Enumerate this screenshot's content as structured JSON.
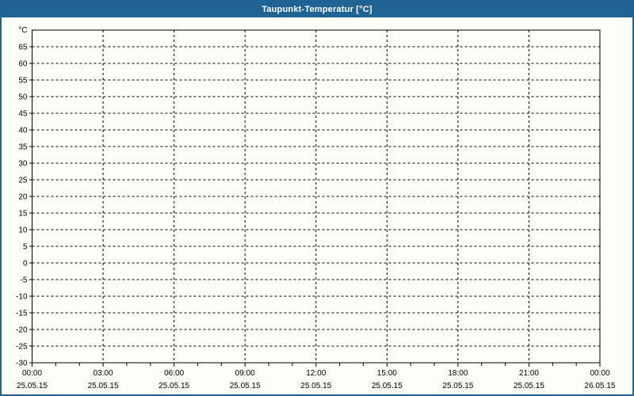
{
  "window": {
    "title": "Taupunkt-Temperatur [°C]",
    "frame_color": "#1e6394",
    "background_color": "#fdfdf8"
  },
  "chart_data": {
    "type": "line",
    "title": "Taupunkt-Temperatur [°C]",
    "y_axis": {
      "unit_label": "°C",
      "min": -30,
      "max": 70,
      "tick_step": 5,
      "tick_labels": [
        65,
        60,
        55,
        50,
        45,
        40,
        35,
        30,
        25,
        20,
        15,
        10,
        5,
        0,
        -5,
        -10,
        -15,
        -20,
        -25,
        -30
      ]
    },
    "x_axis": {
      "major_ticks": [
        {
          "time": "00:00",
          "date": "25.05.15"
        },
        {
          "time": "03:00",
          "date": "25.05.15"
        },
        {
          "time": "06:00",
          "date": "25.05.15"
        },
        {
          "time": "09:00",
          "date": "25.05.15"
        },
        {
          "time": "12:00",
          "date": "25.05.15"
        },
        {
          "time": "15:00",
          "date": "25.05.15"
        },
        {
          "time": "18:00",
          "date": "25.05.15"
        },
        {
          "time": "21:00",
          "date": "25.05.15"
        },
        {
          "time": "00:00",
          "date": "26.05.15"
        }
      ],
      "minor_ticks_per_major_interval": 3
    },
    "grid": {
      "style": "dashed",
      "color": "#000000"
    },
    "legend": "none",
    "series": []
  }
}
